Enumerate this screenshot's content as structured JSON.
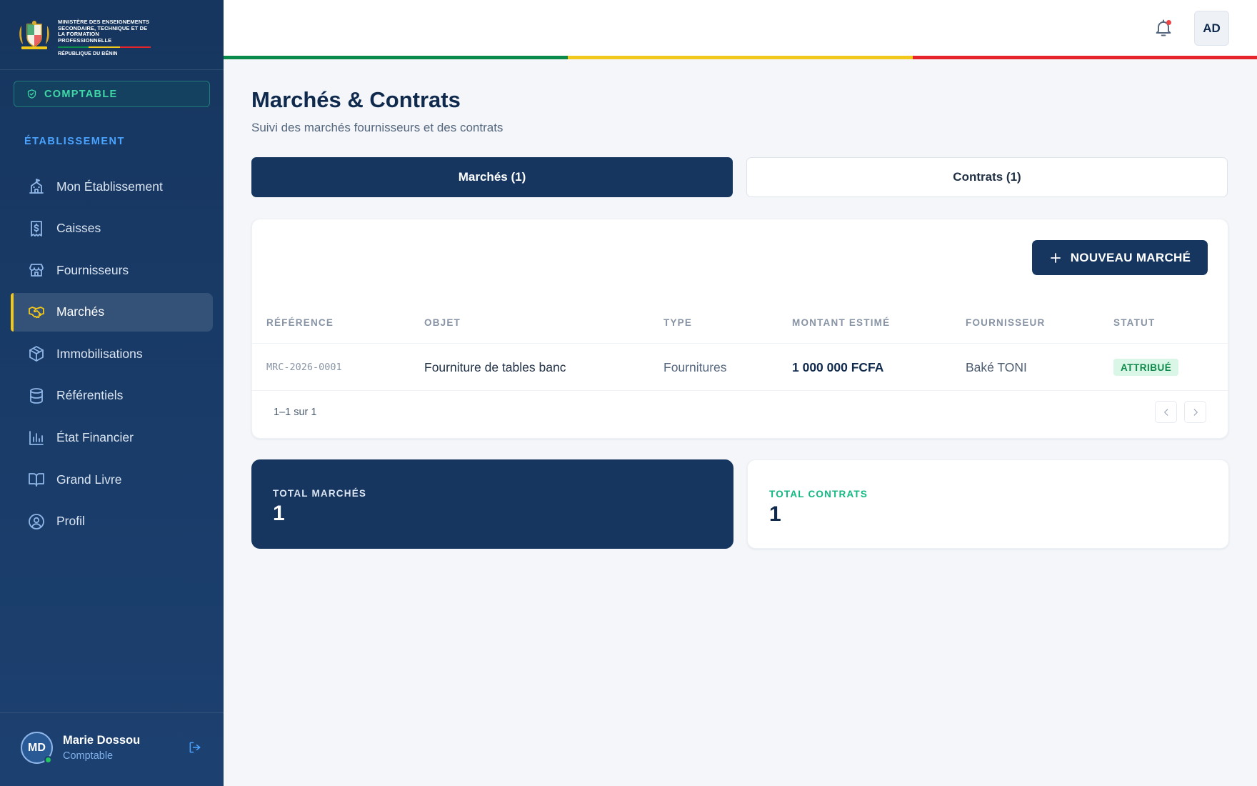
{
  "brand": {
    "ministry": "MINISTÈRE DES ENSEIGNEMENTS SECONDAIRE, TECHNIQUE ET DE LA FORMATION PROFESSIONNELLE",
    "republic": "RÉPUBLIQUE DU BÉNIN",
    "flag_colors": [
      "#0a8a4a",
      "#f2c81a",
      "#e5242c"
    ]
  },
  "role_badge": {
    "label": "COMPTABLE",
    "icon": "shield-check-icon"
  },
  "sidebar": {
    "section_title": "ÉTABLISSEMENT",
    "items": [
      {
        "label": "Mon Établissement",
        "icon": "school-building-icon",
        "active": false
      },
      {
        "label": "Caisses",
        "icon": "cash-receipt-icon",
        "active": false
      },
      {
        "label": "Fournisseurs",
        "icon": "store-icon",
        "active": false
      },
      {
        "label": "Marchés",
        "icon": "handshake-icon",
        "active": true
      },
      {
        "label": "Immobilisations",
        "icon": "box-icon",
        "active": false
      },
      {
        "label": "Référentiels",
        "icon": "database-icon",
        "active": false
      },
      {
        "label": "État Financier",
        "icon": "bar-chart-icon",
        "active": false
      },
      {
        "label": "Grand Livre",
        "icon": "book-open-icon",
        "active": false
      },
      {
        "label": "Profil",
        "icon": "user-circle-icon",
        "active": false
      }
    ]
  },
  "user": {
    "initials": "MD",
    "name": "Marie Dossou",
    "role": "Comptable",
    "status": "online"
  },
  "topbar": {
    "avatar_initials": "AD",
    "notification_icon": "bell-icon",
    "has_notification": true
  },
  "page": {
    "title": "Marchés & Contrats",
    "subtitle": "Suivi des marchés fournisseurs et des contrats"
  },
  "tabs": [
    {
      "label": "Marchés (1)",
      "active": true
    },
    {
      "label": "Contrats (1)",
      "active": false
    }
  ],
  "table": {
    "new_button": "NOUVEAU MARCHÉ",
    "columns": [
      "RÉFÉRENCE",
      "OBJET",
      "TYPE",
      "MONTANT ESTIMÉ",
      "FOURNISSEUR",
      "STATUT"
    ],
    "rows": [
      {
        "reference": "MRC-2026-0001",
        "objet": "Fourniture de tables banc",
        "type": "Fournitures",
        "montant": "1 000 000 FCFA",
        "fournisseur": "Baké TONI",
        "statut": "ATTRIBUÉ"
      }
    ],
    "pagination": "1–1 sur 1"
  },
  "stats": [
    {
      "label": "TOTAL MARCHÉS",
      "value": "1"
    },
    {
      "label": "TOTAL CONTRATS",
      "value": "1"
    }
  ],
  "colors": {
    "primary": "#16365f",
    "accent_yellow": "#f2c81a",
    "success": "#10b981"
  }
}
